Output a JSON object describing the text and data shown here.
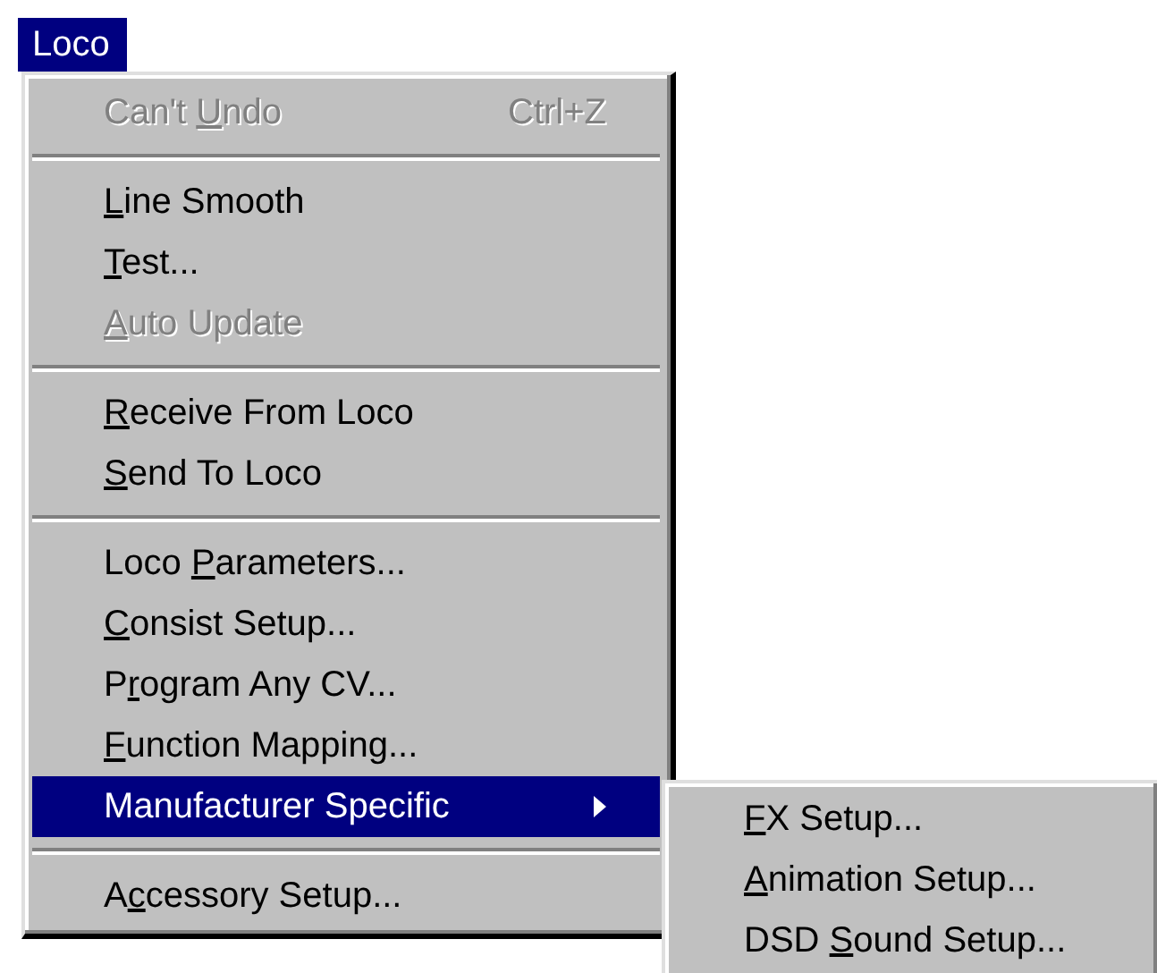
{
  "menu_bar": {
    "title": "Loco",
    "selected": true
  },
  "menu": [
    {
      "kind": "item",
      "label": {
        "before": "Can't ",
        "key": "U",
        "after": "ndo"
      },
      "shortcut": "Ctrl+Z",
      "disabled": true,
      "selected": false
    },
    {
      "kind": "separator"
    },
    {
      "kind": "item",
      "label": {
        "key": "L",
        "after": "ine Smooth"
      },
      "disabled": false,
      "selected": false
    },
    {
      "kind": "item",
      "label": {
        "key": "T",
        "after": "est..."
      },
      "disabled": false,
      "selected": false
    },
    {
      "kind": "item",
      "label": {
        "key": "A",
        "after": "uto Update"
      },
      "disabled": true,
      "selected": false
    },
    {
      "kind": "separator"
    },
    {
      "kind": "item",
      "label": {
        "key": "R",
        "after": "eceive From Loco"
      },
      "disabled": false,
      "selected": false
    },
    {
      "kind": "item",
      "label": {
        "key": "S",
        "after": "end To Loco"
      },
      "disabled": false,
      "selected": false
    },
    {
      "kind": "separator"
    },
    {
      "kind": "item",
      "label": {
        "before": "Loco ",
        "key": "P",
        "after": "arameters..."
      },
      "disabled": false,
      "selected": false
    },
    {
      "kind": "item",
      "label": {
        "key": "C",
        "after": "onsist Setup..."
      },
      "disabled": false,
      "selected": false
    },
    {
      "kind": "item",
      "label": {
        "before": "P",
        "key": "r",
        "after": "ogram Any CV..."
      },
      "disabled": false,
      "selected": false
    },
    {
      "kind": "item",
      "label": {
        "key": "F",
        "after": "unction Mapping..."
      },
      "disabled": false,
      "selected": false
    },
    {
      "kind": "submenu",
      "label": {
        "before": "Manufacturer Specific"
      },
      "disabled": false,
      "selected": true
    },
    {
      "kind": "separator"
    },
    {
      "kind": "item",
      "label": {
        "before": "A",
        "key": "c",
        "after": "cessory Setup..."
      },
      "disabled": false,
      "selected": false
    }
  ],
  "submenu": [
    {
      "kind": "item",
      "label": {
        "key": "F",
        "after": "X Setup..."
      },
      "disabled": false,
      "selected": false
    },
    {
      "kind": "item",
      "label": {
        "key": "A",
        "after": "nimation Setup..."
      },
      "disabled": false,
      "selected": false
    },
    {
      "kind": "item",
      "label": {
        "before": "DSD ",
        "key": "S",
        "after": "ound Setup..."
      },
      "disabled": false,
      "selected": false
    }
  ]
}
